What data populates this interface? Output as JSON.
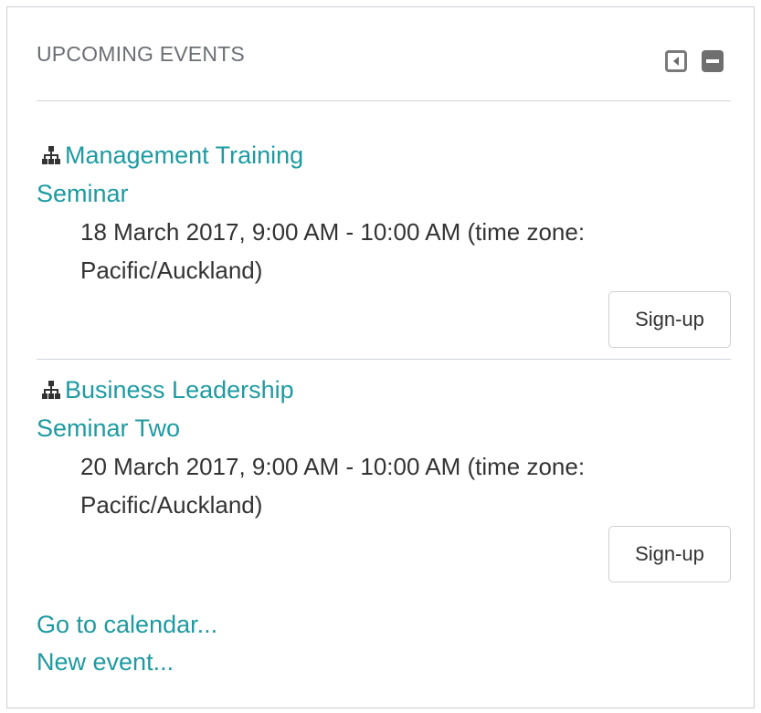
{
  "block": {
    "title": "UPCOMING EVENTS",
    "controls": {
      "dock_icon": "dock-left-icon",
      "hide_icon": "minus-collapse-icon"
    }
  },
  "events": [
    {
      "icon": "course-hierarchy-icon",
      "title_line1": "Management Training",
      "title_line2": "Seminar",
      "date_line1": "18 March 2017, 9:00 AM - 10:00 AM (time zone:",
      "date_line2": "Pacific/Auckland)",
      "signup_label": "Sign-up"
    },
    {
      "icon": "course-hierarchy-icon",
      "title_line1": "Business Leadership",
      "title_line2": "Seminar Two",
      "date_line1": "20 March 2017, 9:00 AM - 10:00 AM (time zone:",
      "date_line2": "Pacific/Auckland)",
      "signup_label": "Sign-up"
    }
  ],
  "footer": {
    "calendar_link": "Go to calendar...",
    "new_event_link": "New event..."
  },
  "colors": {
    "link": "#1d9ba1",
    "title": "#6b6f74",
    "text": "#333333"
  }
}
